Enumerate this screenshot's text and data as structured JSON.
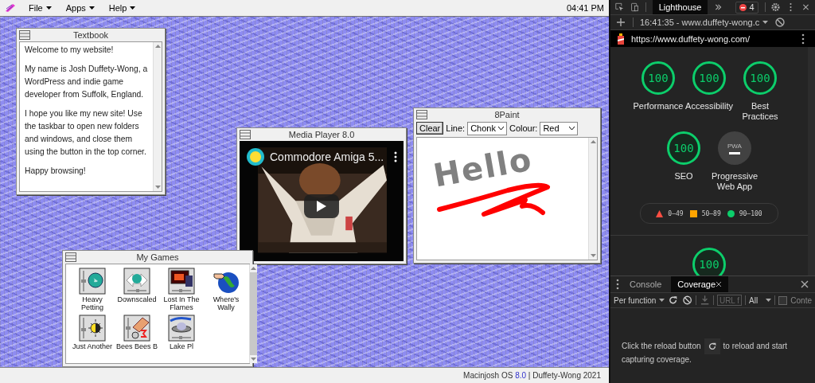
{
  "menu_bar": {
    "menus": [
      {
        "label": "File"
      },
      {
        "label": "Apps"
      },
      {
        "label": "Help"
      }
    ],
    "clock": "04:41 PM"
  },
  "windows": [
    {
      "kind": "text",
      "title": "Textbook",
      "paragraphs": [
        "Welcome to my website!",
        "My name is Josh Duffety-Wong, a WordPress and indie game developer from Suffolk, England.",
        "I hope you like my new site! Use the taskbar to open new folders and windows, and close them using the button in the top corner.",
        "Happy browsing!"
      ]
    },
    {
      "kind": "video",
      "title": "Media Player 8.0",
      "video_title": "Commodore Amiga 5..."
    },
    {
      "kind": "paint",
      "title": "8Paint",
      "clear": "Clear",
      "line_label": "Line:",
      "line_value": "Chonk",
      "colour_label": "Colour:",
      "colour_value": "Red",
      "canvas_text": "Hello"
    },
    {
      "kind": "games",
      "title": "My Games",
      "games": [
        {
          "label": "Heavy Petting"
        },
        {
          "label": "Downscaled"
        },
        {
          "label": "Lost In The Flames"
        },
        {
          "label": "Where's Wally"
        },
        {
          "label": "Just Another"
        },
        {
          "label": "Bees Bees B"
        },
        {
          "label": "Lake Pl"
        }
      ]
    }
  ],
  "footer": {
    "os": "Macinjosh OS ",
    "version": "8.0",
    "credit": " | Duffety-Wong 2021"
  },
  "devtools": {
    "tabs": [
      {
        "label": "Lighthouse",
        "selected": true
      }
    ],
    "error_count": "4",
    "report": "16:41:35 - www.duffety-wong.c",
    "url": "https://www.duffety-wong.com/",
    "scores": [
      {
        "kind": "score",
        "value": "100",
        "label": "Performance"
      },
      {
        "kind": "score",
        "value": "100",
        "label": "Accessibility"
      },
      {
        "kind": "score",
        "value": "100",
        "label": "Best Practices"
      },
      {
        "kind": "score",
        "value": "100",
        "label": "SEO"
      },
      {
        "kind": "pwa",
        "value": "PWA",
        "label": "Progressive Web App"
      }
    ],
    "legend": [
      {
        "kind": "triangle",
        "range": "0–49",
        "color": "#ff4e42"
      },
      {
        "kind": "square",
        "range": "50–89",
        "color": "#ffa400"
      },
      {
        "kind": "circle",
        "range": "90–100",
        "color": "#0cce6b"
      }
    ],
    "extra_score": "100",
    "drawer": {
      "tabs": [
        {
          "label": "Console",
          "selected": false
        },
        {
          "label": "Coverage",
          "selected": true
        }
      ],
      "mode": "Per function",
      "url_placeholder": "URL f",
      "type_filter": "All",
      "content_checkbox": {
        "label": "Conte",
        "checked": false
      },
      "message_before": "Click the reload button",
      "message_after": "to reload and start capturing coverage."
    }
  }
}
